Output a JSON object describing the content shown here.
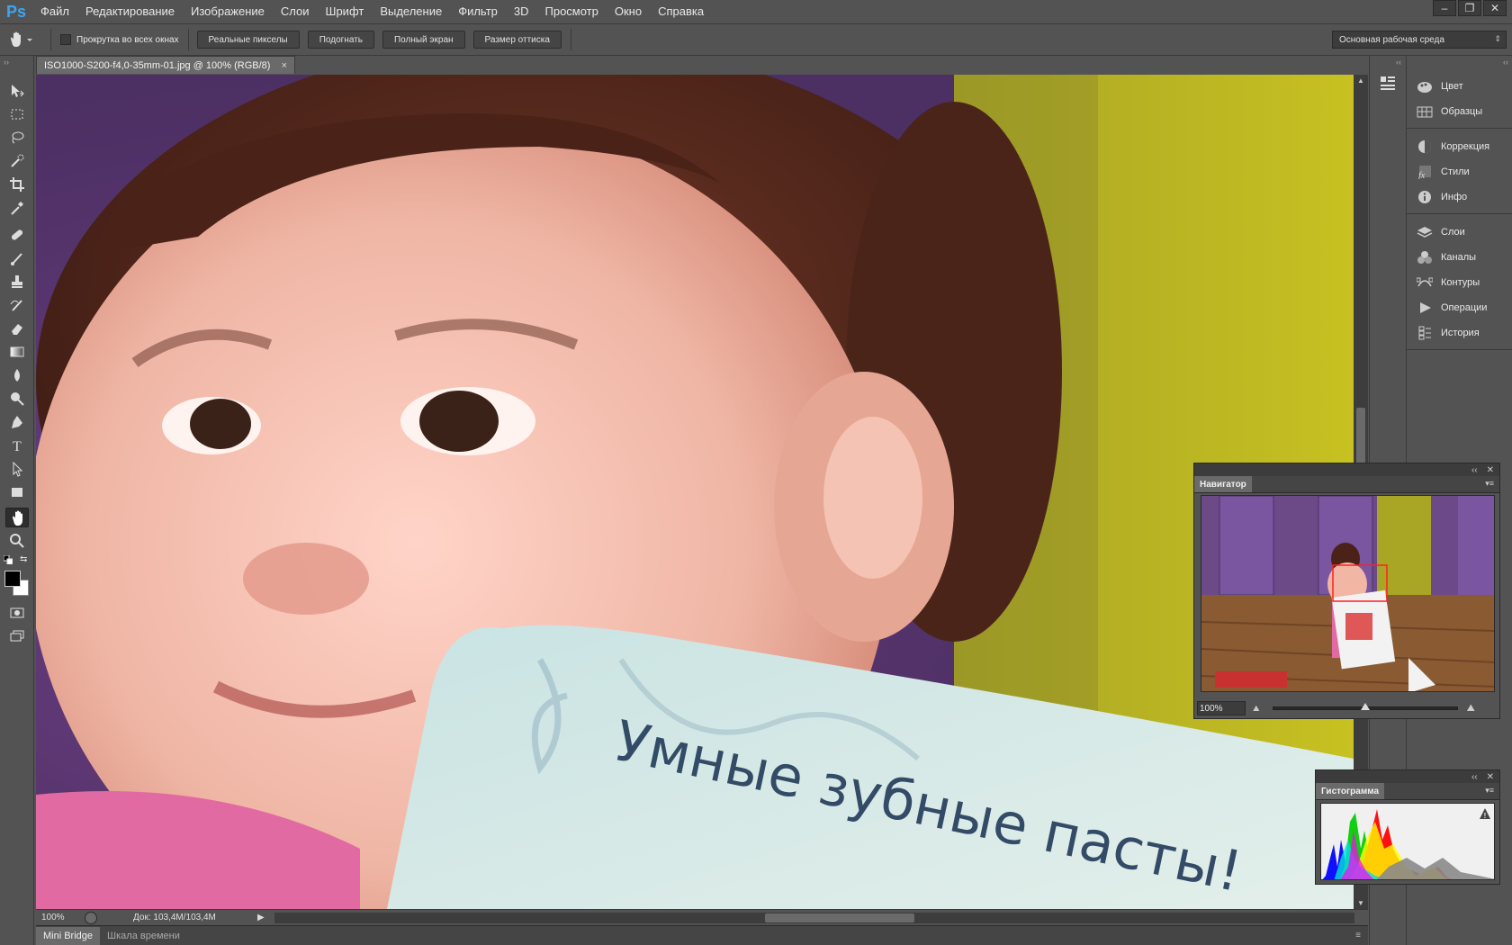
{
  "app": {
    "logo": "Ps",
    "menu": [
      "Файл",
      "Редактирование",
      "Изображение",
      "Слои",
      "Шрифт",
      "Выделение",
      "Фильтр",
      "3D",
      "Просмотр",
      "Окно",
      "Справка"
    ]
  },
  "options_bar": {
    "scroll_all_label": "Прокрутка во всех окнах",
    "scroll_all_checked": false,
    "buttons": [
      "Реальные пикселы",
      "Подогнать",
      "Полный экран",
      "Размер оттиска"
    ],
    "workspace": "Основная рабочая среда"
  },
  "document": {
    "tab_title": "ISO1000-S200-f4,0-35mm-01.jpg @ 100% (RGB/8)",
    "card_text": "Умные зубные пасты!"
  },
  "status": {
    "zoom": "100%",
    "doc_info": "Док: 103,4M/103,4M"
  },
  "bottom_tabs": [
    "Mini Bridge",
    "Шкала времени"
  ],
  "dock": {
    "group1": [
      {
        "label": "Цвет",
        "icon": "color-icon"
      },
      {
        "label": "Образцы",
        "icon": "swatches-icon"
      }
    ],
    "group2": [
      {
        "label": "Коррекция",
        "icon": "adjustments-icon"
      },
      {
        "label": "Стили",
        "icon": "styles-icon"
      },
      {
        "label": "Инфо",
        "icon": "info-icon"
      }
    ],
    "group3": [
      {
        "label": "Слои",
        "icon": "layers-icon"
      },
      {
        "label": "Каналы",
        "icon": "channels-icon"
      },
      {
        "label": "Контуры",
        "icon": "paths-icon"
      },
      {
        "label": "Операции",
        "icon": "actions-icon"
      },
      {
        "label": "История",
        "icon": "history-icon"
      }
    ]
  },
  "navigator": {
    "title": "Навигатор",
    "zoom": "100%",
    "zoom_slider_fraction": 0.5
  },
  "histogram": {
    "title": "Гистограмма",
    "warning": "!"
  },
  "colors": {
    "foreground": "#000000",
    "background": "#ffffff",
    "accent": "#3ea4f0"
  }
}
